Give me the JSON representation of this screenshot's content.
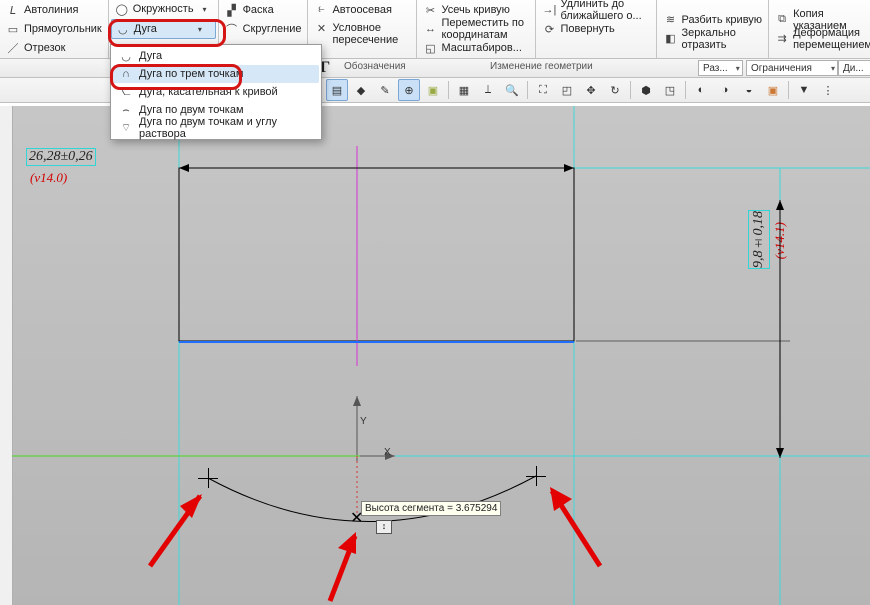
{
  "ribbon": {
    "g1": {
      "a": "Автолиния",
      "b": "Прямоугольник",
      "c": "Отрезок"
    },
    "g2": {
      "a": "Окружность",
      "b": "Дуга"
    },
    "g3": {
      "a": "Фаска",
      "b": "Скругление"
    },
    "g4": {
      "a": "Автоосевая",
      "b": "Условное пересечение"
    },
    "g5": {
      "a": "Усечь кривую",
      "b": "Переместить по координатам",
      "c": "Масштабиров..."
    },
    "g6": {
      "a": "Удлинить до ближайшего о...",
      "b": "Повернуть"
    },
    "g7": {
      "a": "Разбить кривую",
      "b": "Зеркально отразить",
      "c": "Копия указанием",
      "d": "Деформация перемещением"
    }
  },
  "menu": {
    "m1": "Дуга",
    "m2": "Дуга по трем точкам",
    "m3": "Дуга, касательная к кривой",
    "m4": "Дуга по двум точкам",
    "m5": "Дуга по двум точкам и углу раствора"
  },
  "band": {
    "geom": "Г",
    "notes": "Обозначения",
    "change": "Изменение геометрии",
    "size": "Раз...",
    "constr": "Ограничения",
    "diag": "Ди..."
  },
  "dims": {
    "top": "26,28±0,26",
    "top_ver": "(v14.0)",
    "right": "9,8±0,18",
    "right_ver": "(v14.1)"
  },
  "tooltip": "Высота сегмента = 3.675294",
  "axes": {
    "x": "X",
    "y": "Y"
  }
}
